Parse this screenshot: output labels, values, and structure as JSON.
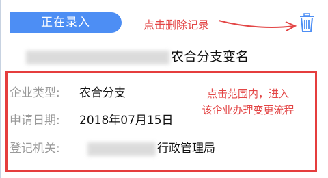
{
  "status_label": "正在录入",
  "annotations": {
    "delete_hint": "点击删除记录",
    "enter_hint_line1": "点击范围内，进入",
    "enter_hint_line2": "该企业办理变更流程"
  },
  "record": {
    "title_visible": "农合分支变名",
    "fields": [
      {
        "label": "企业类型:",
        "value": "农合分支"
      },
      {
        "label": "申请日期:",
        "value": "2018年07月15日"
      },
      {
        "label": "登记机关:",
        "value_visible": "行政管理局"
      }
    ]
  },
  "icons": {
    "delete": "trash-icon"
  },
  "colors": {
    "accent": "#4d8ef4",
    "annotation": "#e34646",
    "box": "#e53e3e"
  }
}
